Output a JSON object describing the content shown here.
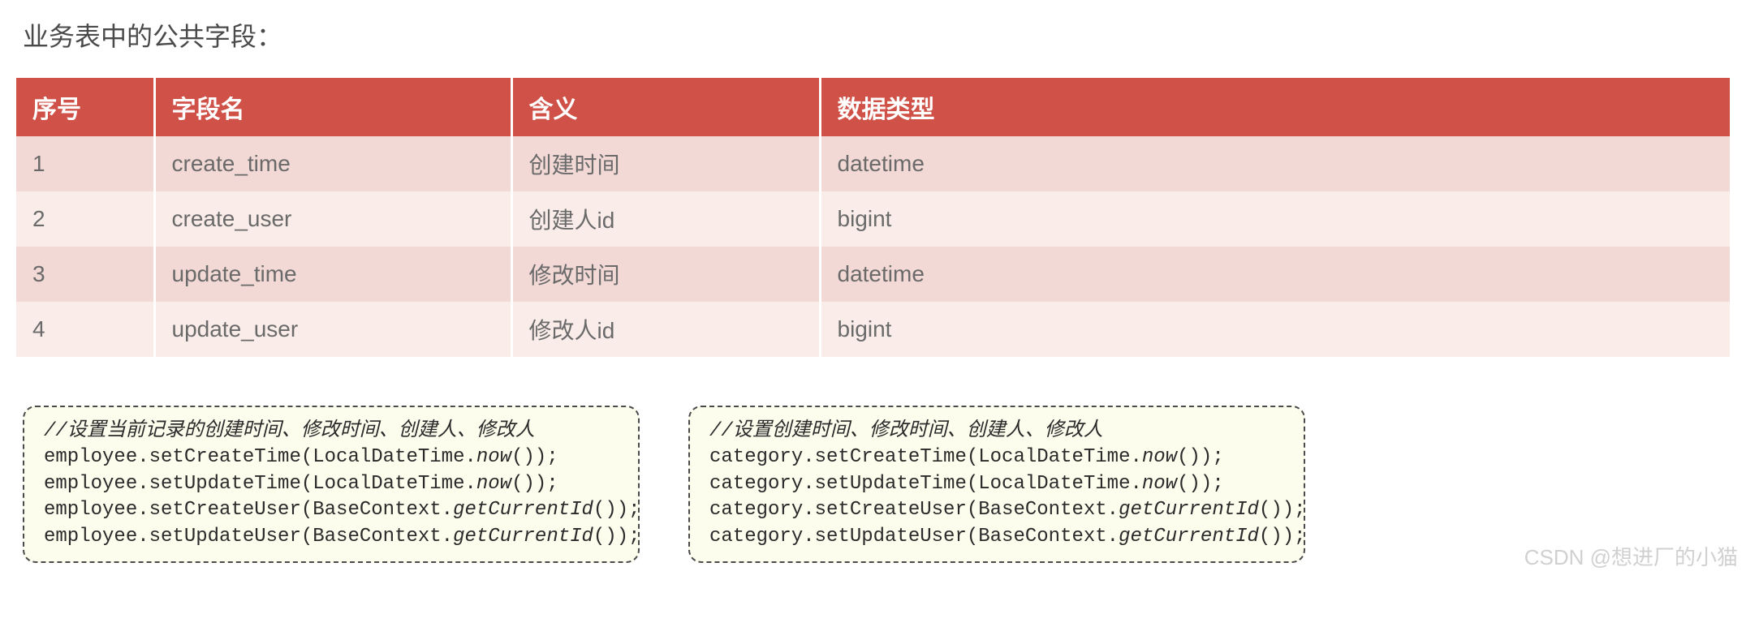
{
  "title": "业务表中的公共字段：",
  "table": {
    "headers": {
      "seq": "序号",
      "field": "字段名",
      "meaning": "含义",
      "type": "数据类型"
    },
    "rows": [
      {
        "seq": "1",
        "field": "create_time",
        "meaning": "创建时间",
        "type": "datetime"
      },
      {
        "seq": "2",
        "field": "create_user",
        "meaning": "创建人id",
        "type": "bigint"
      },
      {
        "seq": "3",
        "field": "update_time",
        "meaning": "修改时间",
        "type": "datetime"
      },
      {
        "seq": "4",
        "field": "update_user",
        "meaning": "修改人id",
        "type": "bigint"
      }
    ]
  },
  "code": {
    "left": {
      "comment": "//设置当前记录的创建时间、修改时间、创建人、修改人",
      "l1a": "employee.setCreateTime(LocalDateTime.",
      "l1b": "now",
      "l1c": "());",
      "l2a": "employee.setUpdateTime(LocalDateTime.",
      "l2b": "now",
      "l2c": "());",
      "l3a": "employee.setCreateUser(BaseContext.",
      "l3b": "getCurrentId",
      "l3c": "());",
      "l4a": "employee.setUpdateUser(BaseContext.",
      "l4b": "getCurrentId",
      "l4c": "());"
    },
    "right": {
      "comment": "//设置创建时间、修改时间、创建人、修改人",
      "l1a": "category.setCreateTime(LocalDateTime.",
      "l1b": "now",
      "l1c": "());",
      "l2a": "category.setUpdateTime(LocalDateTime.",
      "l2b": "now",
      "l2c": "());",
      "l3a": "category.setCreateUser(BaseContext.",
      "l3b": "getCurrentId",
      "l3c": "());",
      "l4a": "category.setUpdateUser(BaseContext.",
      "l4b": "getCurrentId",
      "l4c": "());"
    }
  },
  "watermark": "CSDN @想进厂的小猫"
}
